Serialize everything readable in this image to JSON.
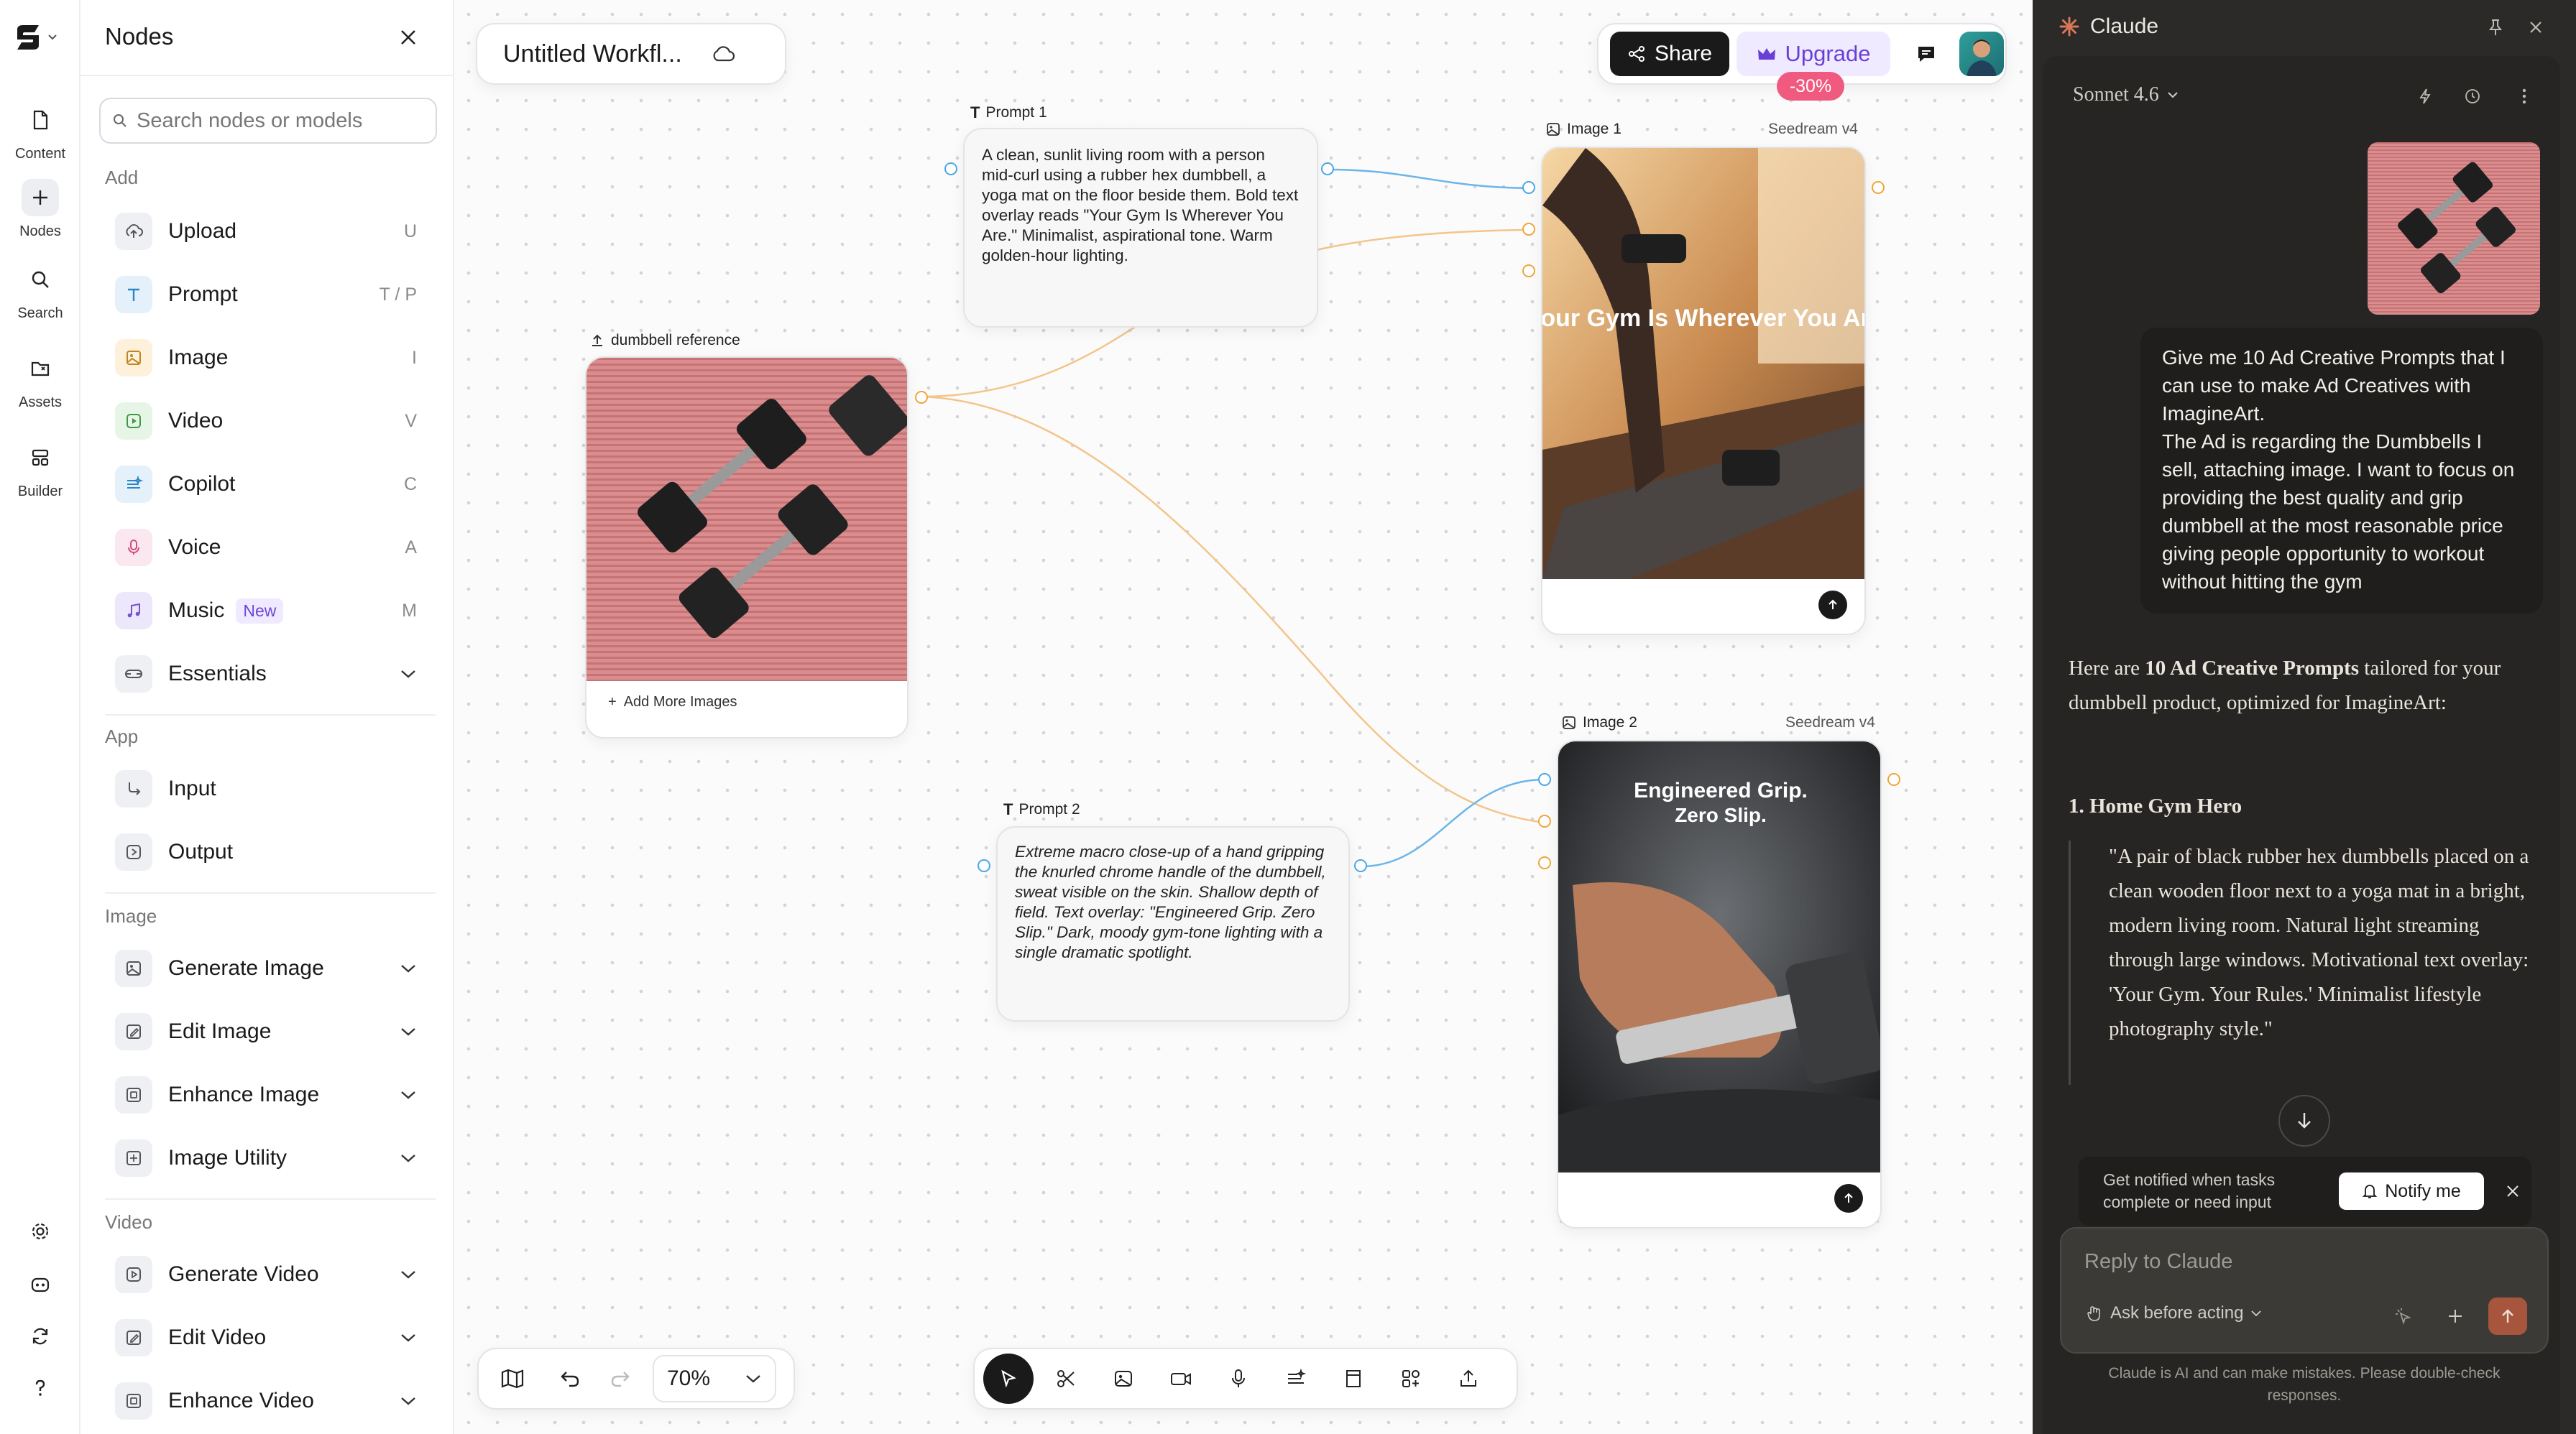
{
  "rail": {
    "items": [
      {
        "label": "Content",
        "icon": "content-icon"
      },
      {
        "label": "Nodes",
        "icon": "plus-icon"
      },
      {
        "label": "Search",
        "icon": "search-icon"
      },
      {
        "label": "Assets",
        "icon": "folder-icon"
      },
      {
        "label": "Builder",
        "icon": "builder-icon"
      }
    ],
    "bottom_icons": [
      "settings-icon",
      "discord-icon",
      "refresh-icon",
      "help-icon"
    ]
  },
  "panel": {
    "title": "Nodes",
    "search_placeholder": "Search nodes or models",
    "sections": {
      "add": "Add",
      "app": "App",
      "image": "Image",
      "video": "Video"
    },
    "add_items": [
      {
        "label": "Upload",
        "key": "U",
        "icon": "upload-icon",
        "color": "#eef0f3"
      },
      {
        "label": "Prompt",
        "key": "T / P",
        "icon": "text-icon",
        "color": "#e4f1fb"
      },
      {
        "label": "Image",
        "key": "I",
        "icon": "image-icon",
        "color": "#fdf1dc"
      },
      {
        "label": "Video",
        "key": "V",
        "icon": "video-icon",
        "color": "#e7f5e7"
      },
      {
        "label": "Copilot",
        "key": "C",
        "icon": "copilot-icon",
        "color": "#e4f1fb"
      },
      {
        "label": "Voice",
        "key": "A",
        "icon": "mic-icon",
        "color": "#fbe7ef"
      },
      {
        "label": "Music",
        "key": "M",
        "badge": "New",
        "icon": "music-icon",
        "color": "#ece7fb"
      },
      {
        "label": "Essentials",
        "icon": "essentials-icon",
        "color": "#eef0f3"
      }
    ],
    "app_items": [
      {
        "label": "Input",
        "icon": "input-icon"
      },
      {
        "label": "Output",
        "icon": "output-icon"
      }
    ],
    "image_items": [
      {
        "label": "Generate Image",
        "icon": "generate-image-icon"
      },
      {
        "label": "Edit Image",
        "icon": "edit-image-icon"
      },
      {
        "label": "Enhance Image",
        "icon": "enhance-image-icon"
      },
      {
        "label": "Image Utility",
        "icon": "image-utility-icon"
      }
    ],
    "video_items": [
      {
        "label": "Generate Video",
        "icon": "generate-video-icon"
      },
      {
        "label": "Edit Video",
        "icon": "edit-video-icon"
      },
      {
        "label": "Enhance Video",
        "icon": "enhance-video-icon"
      }
    ]
  },
  "header": {
    "workflow_title": "Untitled Workfl...",
    "share_label": "Share",
    "upgrade_label": "Upgrade",
    "discount": "-30%"
  },
  "nodes": {
    "reference": {
      "label": "dumbbell reference",
      "add_more": "Add More Images"
    },
    "prompt1": {
      "label": "Prompt 1",
      "text": "A clean, sunlit living room with a person mid-curl using a rubber hex dumbbell, a yoga mat on the floor beside them. Bold text overlay reads \"Your Gym Is Wherever You Are.\" Minimalist, aspirational tone. Warm golden-hour lighting."
    },
    "prompt2": {
      "label": "Prompt 2",
      "text": "Extreme macro close-up of a hand gripping the knurled chrome handle of the dumbbell, sweat visible on the skin. Shallow depth of field. Text overlay: \"Engineered Grip. Zero Slip.\" Dark, moody gym-tone lighting with a single dramatic spotlight."
    },
    "image1": {
      "label": "Image 1",
      "model": "Seedream v4",
      "overlay": "Your Gym Is Wherever You Are"
    },
    "image2": {
      "label": "Image 2",
      "model": "Seedream v4",
      "overlay_line1": "Engineered Grip.",
      "overlay_line2": "Zero Slip."
    }
  },
  "toolbar": {
    "zoom": "70%"
  },
  "claude": {
    "title": "Claude",
    "model": "Sonnet 4.6",
    "user_message": "Give me 10 Ad Creative Prompts that I can use to make Ad Creatives with ImagineArt.\nThe Ad is regarding the Dumbbells I sell, attaching image. I want to focus on providing the best quality and grip dumbbell at the most reasonable price giving people opportunity to workout without hitting the gym",
    "response_intro_pre": "Here are ",
    "response_intro_bold": "10 Ad Creative Prompts",
    "response_intro_post": " tailored for your dumbbell product, optimized for ImagineArt:",
    "item1_title": "1. Home Gym Hero",
    "item1_quote": "\"A pair of black rubber hex dumbbells placed on a clean wooden floor next to a yoga mat in a bright, modern living room. Natural light streaming through large windows. Motivational text overlay: 'Your Gym. Your Rules.' Minimalist lifestyle photography style.\"",
    "notify_text": "Get notified when tasks complete or need input",
    "notify_button": "Notify me",
    "reply_placeholder": "Reply to Claude",
    "ask_mode": "Ask before acting",
    "disclaimer": "Claude is AI and can make mistakes. Please double-check responses."
  }
}
